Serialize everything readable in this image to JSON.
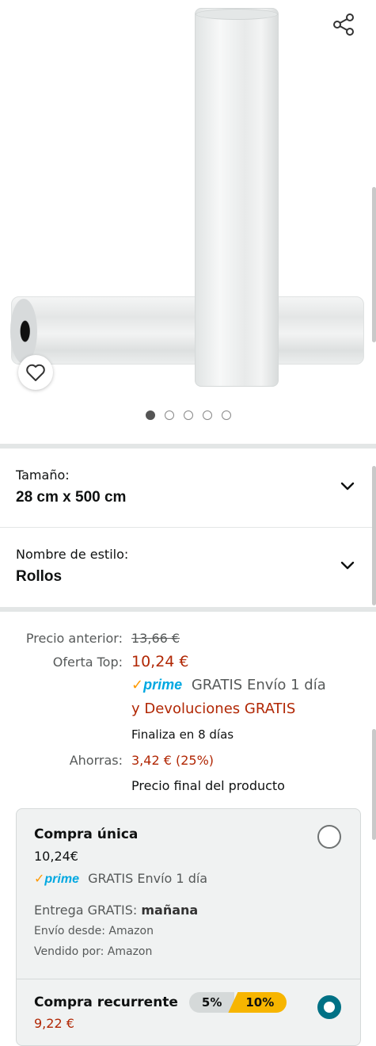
{
  "gallery": {
    "dots": [
      true,
      false,
      false,
      false,
      false
    ]
  },
  "variants": [
    {
      "label": "Tamaño:",
      "value": "28 cm x 500 cm"
    },
    {
      "label": "Nombre de estilo:",
      "value": "Rollos"
    }
  ],
  "pricing": {
    "previous_label": "Precio anterior:",
    "previous_value": "13,66 €",
    "deal_label": "Oferta Top:",
    "deal_value": "10,24 €",
    "prime_check": "✓",
    "prime_word": "prime",
    "shipping_line1": "GRATIS Envío 1 día",
    "shipping_line2": "y Devoluciones GRATIS",
    "ends": "Finaliza en 8 días",
    "savings_label": "Ahorras:",
    "savings_value": "3,42 € (25%)",
    "final_note": "Precio final del producto"
  },
  "purchase_options": {
    "one_time": {
      "title": "Compra única",
      "price": "10,24€",
      "shipping": "GRATIS Envío 1 día",
      "delivery_prefix": "Entrega GRATIS:",
      "delivery_day": "mañana",
      "ships_from": "Envío desde: Amazon",
      "sold_by": "Vendido por: Amazon"
    },
    "recurring": {
      "title": "Compra recurrente",
      "pill_low": "5%",
      "pill_high": "10%",
      "price": "9,22 €"
    }
  },
  "colors": {
    "price_red": "#b12704",
    "link_teal": "#007185",
    "prime_blue": "#00a8e1",
    "prime_orange": "#ff9900",
    "radio_selected": "#007185"
  }
}
